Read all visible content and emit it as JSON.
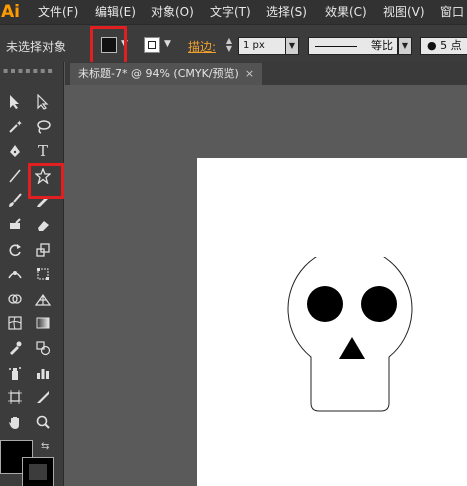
{
  "app": {
    "logo": "Ai"
  },
  "menu": {
    "items": [
      {
        "label": "文件(F)"
      },
      {
        "label": "编辑(E)"
      },
      {
        "label": "对象(O)"
      },
      {
        "label": "文字(T)"
      },
      {
        "label": "选择(S)"
      },
      {
        "label": "效果(C)"
      },
      {
        "label": "视图(V)"
      },
      {
        "label": "窗口"
      }
    ]
  },
  "control": {
    "selection_status": "未选择对象",
    "stroke_label": "描边:",
    "stroke_weight": "1 px",
    "profile_label": "等比",
    "brush_value": "5 点"
  },
  "document": {
    "tab_title": "未标题-7* @ 94% (CMYK/预览)",
    "close": "×"
  },
  "colors": {
    "highlight": "#e02020",
    "logo": "#ff9a00",
    "stroke_label": "#f0a030"
  },
  "tools": [
    {
      "name": "selection-tool-icon"
    },
    {
      "name": "direct-selection-tool-icon"
    },
    {
      "name": "magic-wand-tool-icon"
    },
    {
      "name": "lasso-tool-icon"
    },
    {
      "name": "pen-tool-icon"
    },
    {
      "name": "type-tool-icon",
      "glyph": "T"
    },
    {
      "name": "line-segment-tool-icon"
    },
    {
      "name": "star-tool-icon"
    },
    {
      "name": "paintbrush-tool-icon"
    },
    {
      "name": "pencil-tool-icon"
    },
    {
      "name": "blob-brush-tool-icon"
    },
    {
      "name": "eraser-tool-icon"
    },
    {
      "name": "rotate-tool-icon"
    },
    {
      "name": "scale-tool-icon"
    },
    {
      "name": "width-tool-icon"
    },
    {
      "name": "free-transform-tool-icon"
    },
    {
      "name": "shape-builder-tool-icon"
    },
    {
      "name": "perspective-grid-tool-icon"
    },
    {
      "name": "mesh-tool-icon"
    },
    {
      "name": "gradient-tool-icon"
    },
    {
      "name": "eyedropper-tool-icon"
    },
    {
      "name": "blend-tool-icon"
    },
    {
      "name": "symbol-sprayer-tool-icon"
    },
    {
      "name": "column-graph-tool-icon"
    },
    {
      "name": "artboard-tool-icon"
    },
    {
      "name": "slice-tool-icon"
    },
    {
      "name": "hand-tool-icon"
    },
    {
      "name": "zoom-tool-icon"
    }
  ]
}
